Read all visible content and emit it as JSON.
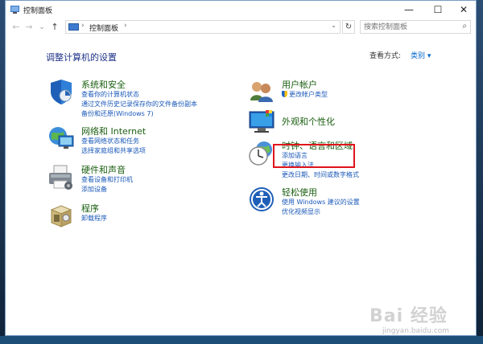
{
  "window": {
    "title": "控制面板",
    "minimize": "—",
    "maximize": "☐",
    "close": "✕"
  },
  "nav": {
    "back": "←",
    "forward": "→",
    "recent": "⌄",
    "up": "↑",
    "address_sep": "›",
    "address_path": "控制面板",
    "refresh": "↻",
    "search_placeholder": "搜索控制面板"
  },
  "main": {
    "heading": "调整计算机的设置",
    "view_by_label": "查看方式:",
    "view_by_value": "类别 ▾"
  },
  "categories": [
    {
      "title": "系统和安全",
      "links": [
        "查看你的计算机状态",
        "通过文件历史记录保存你的文件备份副本",
        "备份和还原(Windows 7)"
      ]
    },
    {
      "title": "网络和 Internet",
      "links": [
        "查看网络状态和任务",
        "选择家庭组和共享选项"
      ]
    },
    {
      "title": "硬件和声音",
      "links": [
        "查看设备和打印机",
        "添加设备"
      ]
    },
    {
      "title": "程序",
      "links": [
        "卸载程序"
      ]
    },
    {
      "title": "用户帐户",
      "links": [
        "更改帐户类型"
      ]
    },
    {
      "title": "外观和个性化",
      "links": []
    },
    {
      "title": "时钟、语言和区域",
      "links": [
        "添加语言",
        "更换输入法",
        "更改日期、时间或数字格式"
      ]
    },
    {
      "title": "轻松使用",
      "links": [
        "使用 Windows 建议的设置",
        "优化视频显示"
      ]
    }
  ],
  "watermark": {
    "logo": "Bai 经验",
    "url": "jingyan.baidu.com"
  }
}
